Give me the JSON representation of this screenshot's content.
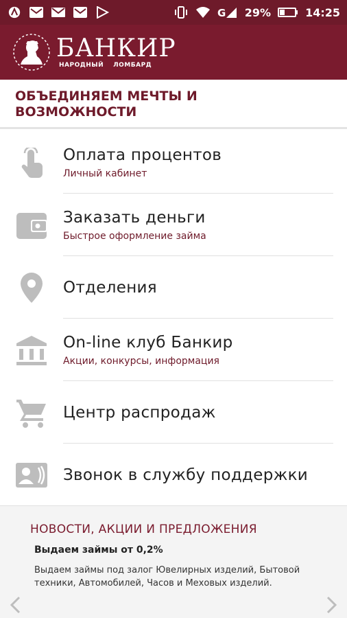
{
  "status_bar": {
    "battery": "29%",
    "time": "14:25",
    "icons": [
      "app-a-icon",
      "gmail-icon",
      "mail-icon",
      "gmail-icon",
      "play-store-icon",
      "vibrate-icon",
      "wifi-icon",
      "signal-icon",
      "battery-icon"
    ]
  },
  "header": {
    "brand_name": "БАНКИР",
    "brand_sub_1": "народный",
    "brand_sub_2": "ломбард"
  },
  "slogan": "ОБЪЕДИНЯЕМ МЕЧТЫ И ВОЗМОЖНОСТИ",
  "menu": {
    "items": [
      {
        "title": "Оплата процентов",
        "subtitle": "Личный кабинет",
        "icon": "touch-hand-icon"
      },
      {
        "title": "Заказать деньги",
        "subtitle": "Быстрое оформление займа",
        "icon": "wallet-icon"
      },
      {
        "title": "Отделения",
        "subtitle": "",
        "icon": "location-pin-icon"
      },
      {
        "title": "On-line клуб Банкир",
        "subtitle": "Акции, конкурсы, информация",
        "icon": "bank-building-icon"
      },
      {
        "title": "Центр распродаж",
        "subtitle": "",
        "icon": "shopping-cart-icon"
      },
      {
        "title": "Звонок в службу поддержки",
        "subtitle": "",
        "icon": "contact-phone-icon"
      }
    ]
  },
  "news": {
    "section_title": "НОВОСТИ, АКЦИИ И ПРЕДЛОЖЕНИЯ",
    "headline": "Выдаем займы от 0,2%",
    "body": "Выдаем займы под залог Ювелирных изделий, Бытовой техники, Автомобилей, Часов и Меховых изделий."
  },
  "colors": {
    "brand": "#7a1b2e",
    "icon_gray": "#bdbdbd",
    "divider": "#e0e0e0"
  }
}
